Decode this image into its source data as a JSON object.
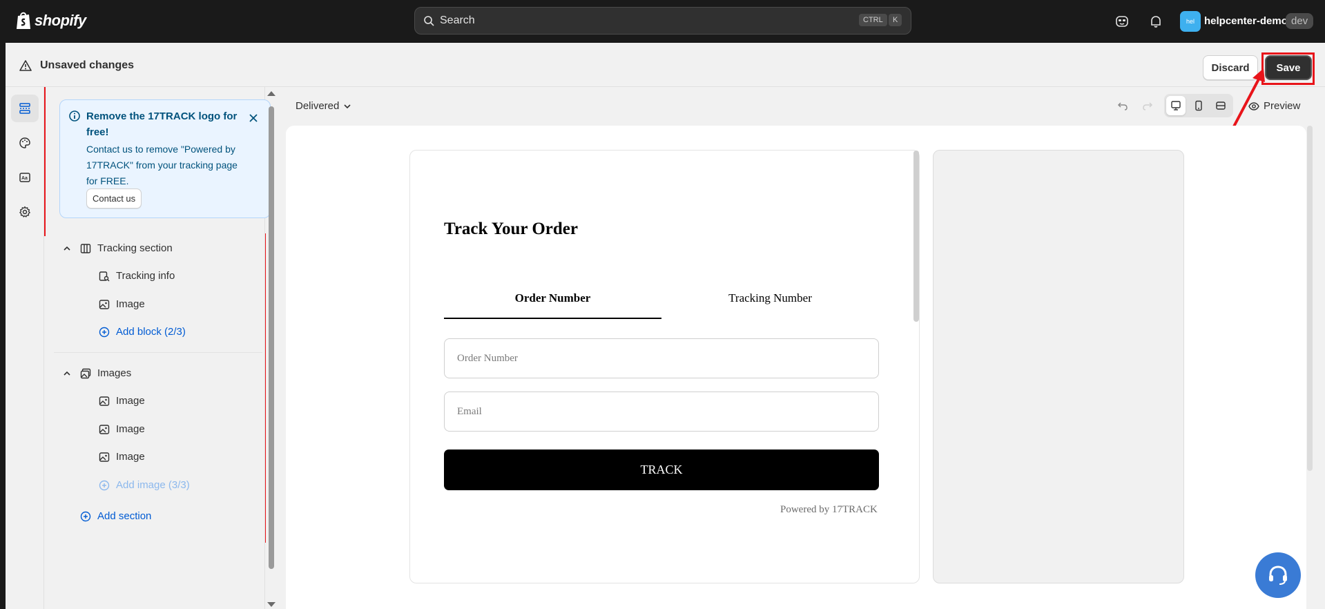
{
  "topbar": {
    "brand": "shopify",
    "search_placeholder": "Search",
    "search_kbd1": "CTRL",
    "search_kbd2": "K",
    "store_initials": "hel",
    "store_name": "helpcenter-demo",
    "store_env": "dev"
  },
  "editor": {
    "status_title": "Unsaved changes",
    "discard_label": "Discard",
    "save_label": "Save"
  },
  "banner": {
    "title": "Remove the 17TRACK logo for free!",
    "body": "Contact us to remove \"Powered by 17TRACK\" from your tracking page for FREE.",
    "button_label": "Contact us"
  },
  "tree": {
    "section1": "Tracking section",
    "section1_items": [
      "Tracking info",
      "Image"
    ],
    "add_block": "Add block (2/3)",
    "section2": "Images",
    "section2_items": [
      "Image",
      "Image",
      "Image"
    ],
    "add_image": "Add image (3/3)",
    "add_section": "Add section"
  },
  "canvas": {
    "status": "Delivered",
    "preview_label": "Preview"
  },
  "tracking_page": {
    "title": "Track Your Order",
    "tab_order": "Order Number",
    "tab_tracking": "Tracking Number",
    "order_placeholder": "Order Number",
    "email_placeholder": "Email",
    "track_button": "TRACK",
    "powered_by": "Powered by 17TRACK"
  },
  "colors": {
    "accent_blue": "#005bd3",
    "highlight_red": "#e8141a",
    "fab_blue": "#3a7bd5"
  }
}
